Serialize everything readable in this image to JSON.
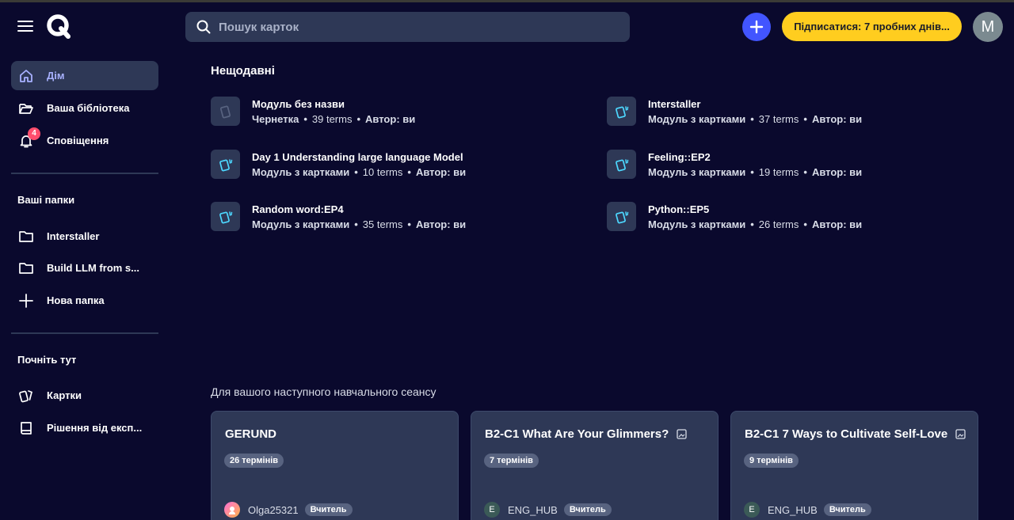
{
  "header": {
    "search_placeholder": "Пошук карток",
    "subscribe_label": "Підписатися: 7 пробних днів...",
    "avatar_letter": "M"
  },
  "sidebar": {
    "items": [
      {
        "label": "Дім",
        "icon": "home-icon"
      },
      {
        "label": "Ваша бібліотека",
        "icon": "folder-open-icon"
      },
      {
        "label": "Сповіщення",
        "icon": "bell-icon",
        "badge": "4"
      }
    ],
    "folders_heading": "Ваші папки",
    "folders": [
      {
        "label": "Interstaller",
        "icon": "folder-icon"
      },
      {
        "label": "Build LLM from s...",
        "icon": "folder-icon"
      },
      {
        "label": "Нова папка",
        "icon": "plus-icon"
      }
    ],
    "start_heading": "Почніть тут",
    "start_items": [
      {
        "label": "Картки",
        "icon": "cards-icon"
      },
      {
        "label": "Рішення від експ...",
        "icon": "book-icon"
      }
    ]
  },
  "recent": {
    "title": "Нещодавні",
    "items": [
      {
        "title": "Модуль без назви",
        "kind": "Чернетка",
        "terms": "39 terms",
        "author": "Автор: ви",
        "draft": true
      },
      {
        "title": "Interstaller",
        "kind": "Модуль з картками",
        "terms": "37 terms",
        "author": "Автор: ви"
      },
      {
        "title": "Day 1 Understanding large language Model",
        "kind": "Модуль з картками",
        "terms": "10 terms",
        "author": "Автор: ви"
      },
      {
        "title": "Feeling::EP2",
        "kind": "Модуль з картками",
        "terms": "19 terms",
        "author": "Автор: ви"
      },
      {
        "title": "Random word:EP4",
        "kind": "Модуль з картками",
        "terms": "35 terms",
        "author": "Автор: ви"
      },
      {
        "title": "Python::EP5",
        "kind": "Модуль з картками",
        "terms": "26 terms",
        "author": "Автор: ви"
      }
    ]
  },
  "next_session": {
    "title": "Для вашого наступного навчального сеансу",
    "cards": [
      {
        "title": "GERUND",
        "terms": "26 термінів",
        "author": "Olga25321",
        "role": "Вчитель",
        "has_image_icon": false
      },
      {
        "title": "B2-C1 What Are Your Glimmers?",
        "terms": "7 термінів",
        "author": "ENG_HUB",
        "role": "Вчитель",
        "avatar_letter": "E",
        "has_image_icon": true
      },
      {
        "title": "B2-C1 7 Ways to Cultivate Self-Love",
        "terms": "9 термінів",
        "author": "ENG_HUB",
        "role": "Вчитель",
        "avatar_letter": "E",
        "has_image_icon": true
      }
    ]
  },
  "colors": {
    "background": "#0a092d",
    "panel": "#2e3856",
    "accent": "#4255ff",
    "subscribe": "#ffcd1f",
    "active_label": "#a8b1ff",
    "badge": "#ff4d6d"
  }
}
